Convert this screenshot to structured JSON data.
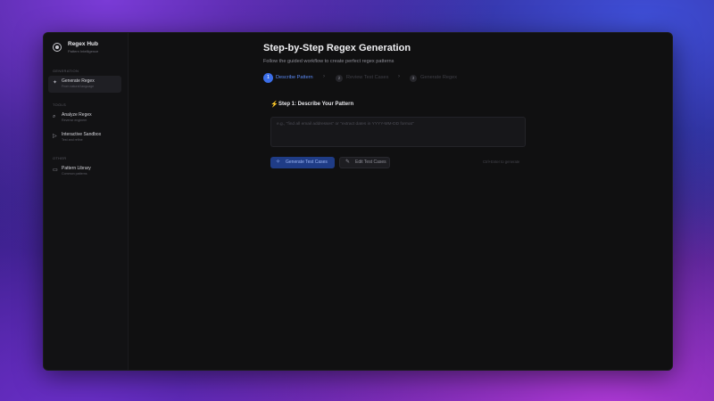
{
  "brand": {
    "title": "Regex Hub",
    "subtitle": "Pattern Intelligence",
    "logo_icon": "logo-icon"
  },
  "sidebar": {
    "sections": [
      {
        "label": "GENERATION",
        "items": [
          {
            "label": "Generate Regex",
            "sub": "From natural language",
            "icon": "sparkle-icon",
            "active": true
          }
        ]
      },
      {
        "label": "TOOLS",
        "items": [
          {
            "label": "Analyze Regex",
            "sub": "Reverse engineer",
            "icon": "search-icon",
            "active": false
          },
          {
            "label": "Interactive Sandbox",
            "sub": "Test and refine",
            "icon": "play-icon",
            "active": false
          }
        ]
      },
      {
        "label": "OTHER",
        "items": [
          {
            "label": "Pattern Library",
            "sub": "Common patterns",
            "icon": "book-icon",
            "active": false
          }
        ]
      }
    ]
  },
  "main": {
    "title": "Step-by-Step Regex Generation",
    "subtitle": "Follow the guided workflow to create perfect regex patterns",
    "steps": [
      {
        "num": "1",
        "label": "Describe Pattern",
        "active": true
      },
      {
        "num": "2",
        "label": "Review Test Cases",
        "active": false
      },
      {
        "num": "3",
        "label": "Generate Regex",
        "active": false
      }
    ],
    "card": {
      "title": "Step 1: Describe Your Pattern",
      "placeholder": "e.g., \"find all email addresses\" or \"extract dates in YYYY-MM-DD format\"",
      "primary_button": "Generate Test Cases",
      "secondary_button": "Edit Test Cases",
      "hint": "Ctrl+Enter to generate"
    }
  },
  "colors": {
    "accent": "#3b6ee8",
    "window_bg": "#101011",
    "sidebar_bg": "#121214"
  }
}
